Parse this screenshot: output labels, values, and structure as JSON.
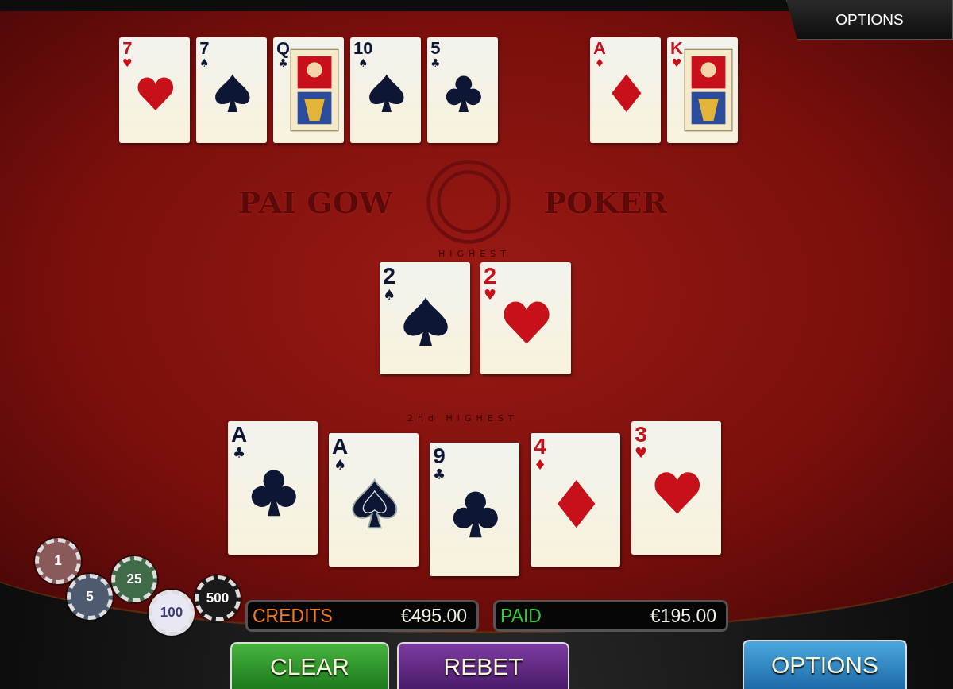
{
  "top_bar": {
    "options": "OPTIONS"
  },
  "top_row_left": [
    {
      "rank": "7",
      "suit": "♥",
      "color": "#c8101a",
      "kind": "hearts"
    },
    {
      "rank": "7",
      "suit": "♠",
      "color": "#0d1733",
      "kind": "spades"
    },
    {
      "rank": "Q",
      "suit": "♣",
      "color": "#0d1733",
      "kind": "face"
    },
    {
      "rank": "10",
      "suit": "♠",
      "color": "#0d1733",
      "kind": "spades"
    },
    {
      "rank": "5",
      "suit": "♣",
      "color": "#0d1733",
      "kind": "clubs"
    }
  ],
  "top_row_right": [
    {
      "rank": "A",
      "suit": "♦",
      "color": "#c8101a",
      "kind": "diamonds"
    },
    {
      "rank": "K",
      "suit": "♥",
      "color": "#c8101a",
      "kind": "face"
    }
  ],
  "table": {
    "title_left": "PAI GOW",
    "title_right": "POKER",
    "highest_label": "HIGHEST",
    "second_label": "2nd HIGHEST"
  },
  "highest_hand": [
    {
      "rank": "2",
      "suit": "♠",
      "color": "#0d1733",
      "kind": "spades"
    },
    {
      "rank": "2",
      "suit": "♥",
      "color": "#c8101a",
      "kind": "hearts"
    }
  ],
  "second_hand": [
    {
      "rank": "A",
      "suit": "♣",
      "color": "#0d1733",
      "kind": "clubs"
    },
    {
      "rank": "A",
      "suit": "♠",
      "color": "#0d1733",
      "kind": "ornate"
    },
    {
      "rank": "9",
      "suit": "♣",
      "color": "#0d1733",
      "kind": "clubs"
    },
    {
      "rank": "4",
      "suit": "♦",
      "color": "#c8101a",
      "kind": "diamonds"
    },
    {
      "rank": "3",
      "suit": "♥",
      "color": "#c8101a",
      "kind": "hearts"
    }
  ],
  "chips": [
    {
      "label": "1",
      "color": "#8a5a5a"
    },
    {
      "label": "5",
      "color": "#4d5a70"
    },
    {
      "label": "25",
      "color": "#3f6b48"
    },
    {
      "label": "100",
      "color": "#e8e8f4"
    },
    {
      "label": "500",
      "color": "#1a1a1a"
    }
  ],
  "credits": {
    "label": "CREDITS",
    "value": "€495.00"
  },
  "paid": {
    "label": "PAID",
    "value": "€195.00"
  },
  "buttons": [
    {
      "label": "CLEAR",
      "kind": "clear"
    },
    {
      "label": "REBET",
      "kind": "rebet"
    },
    {
      "label": "OPTIONS",
      "kind": "options"
    }
  ]
}
